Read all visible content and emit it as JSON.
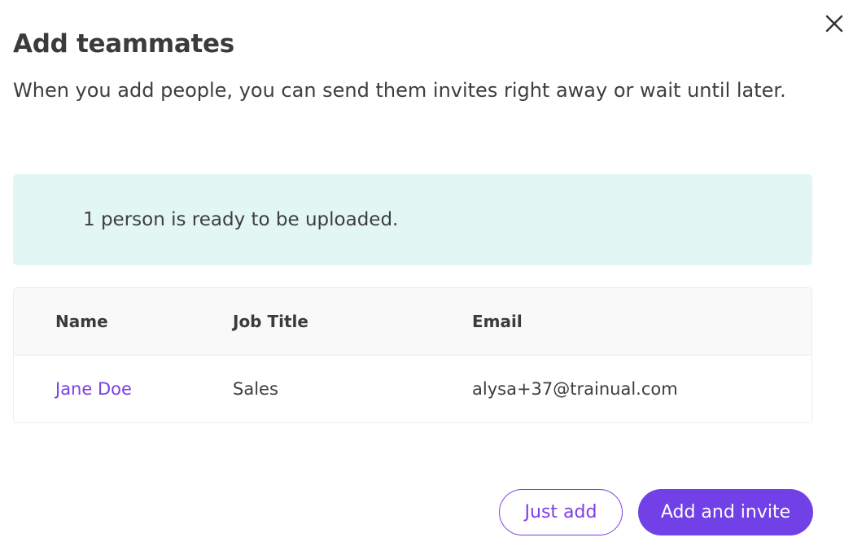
{
  "modal": {
    "title": "Add teammates",
    "subtitle": "When you add people, you can send them invites right away or wait until later.",
    "close_icon": "close-icon"
  },
  "banner": {
    "message": "1 person is ready to be uploaded."
  },
  "table": {
    "headers": {
      "name": "Name",
      "job_title": "Job Title",
      "email": "Email"
    },
    "rows": [
      {
        "name": "Jane Doe",
        "job_title": "Sales",
        "email": "alysa+37@trainual.com"
      }
    ]
  },
  "actions": {
    "secondary_label": "Just add",
    "primary_label": "Add and invite"
  },
  "colors": {
    "accent": "#7140e6",
    "link": "#7c3fe4",
    "banner_bg": "#e2f7f3"
  }
}
